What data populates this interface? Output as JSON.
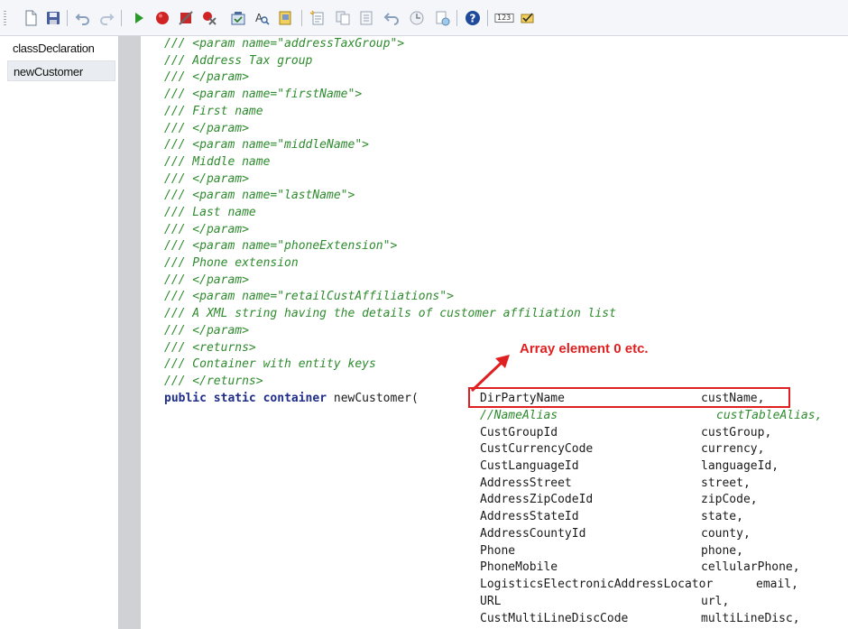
{
  "toolbar": {
    "buttons": [
      {
        "name": "new-icon"
      },
      {
        "name": "save-icon"
      },
      {
        "name": "undo-icon"
      },
      {
        "name": "redo-icon"
      },
      {
        "name": "run-icon"
      },
      {
        "name": "breakpoint-icon"
      },
      {
        "name": "enable-breakpoint-icon"
      },
      {
        "name": "remove-breakpoints-icon"
      },
      {
        "name": "compile-icon"
      },
      {
        "name": "lookup-icon"
      },
      {
        "name": "script-icon"
      },
      {
        "name": "new-method-icon"
      },
      {
        "name": "copy-icon"
      },
      {
        "name": "outline-icon"
      },
      {
        "name": "back-icon"
      },
      {
        "name": "history-icon"
      },
      {
        "name": "source-control-icon"
      },
      {
        "name": "help-icon"
      },
      {
        "name": "line-numbers-icon"
      },
      {
        "name": "best-practice-icon"
      }
    ],
    "line_numbers_label": "123"
  },
  "sidebar": {
    "items": [
      {
        "label": "classDeclaration",
        "selected": false
      },
      {
        "label": "newCustomer",
        "selected": true
      }
    ]
  },
  "code": {
    "comment_lines": [
      "/// <param name=\"addressTaxGroup\">",
      "/// Address Tax group",
      "/// </param>",
      "/// <param name=\"firstName\">",
      "/// First name",
      "/// </param>",
      "/// <param name=\"middleName\">",
      "/// Middle name",
      "/// </param>",
      "/// <param name=\"lastName\">",
      "/// Last name",
      "/// </param>",
      "/// <param name=\"phoneExtension\">",
      "/// Phone extension",
      "/// </param>",
      "/// <param name=\"retailCustAffiliations\">",
      "/// A XML string having the details of customer affiliation list",
      "/// </param>",
      "/// <returns>",
      "/// Container with entity keys",
      "/// </returns>"
    ],
    "signature": {
      "kw_public": "public",
      "kw_static": "static",
      "kw_container": "container",
      "method": "newCustomer("
    },
    "params": [
      {
        "type": "DirPartyName",
        "name": "custName,",
        "commented": false
      },
      {
        "type": "//NameAlias",
        "name": "custTableAlias,",
        "commented": true
      },
      {
        "type": "CustGroupId",
        "name": "custGroup,",
        "commented": false
      },
      {
        "type": "CustCurrencyCode",
        "name": "currency,",
        "commented": false
      },
      {
        "type": "CustLanguageId",
        "name": "languageId,",
        "commented": false
      },
      {
        "type": "AddressStreet",
        "name": "street,",
        "commented": false
      },
      {
        "type": "AddressZipCodeId",
        "name": "zipCode,",
        "commented": false
      },
      {
        "type": "AddressStateId",
        "name": "state,",
        "commented": false
      },
      {
        "type": "AddressCountyId",
        "name": "county,",
        "commented": false
      },
      {
        "type": "Phone",
        "name": "phone,",
        "commented": false
      },
      {
        "type": "PhoneMobile",
        "name": "cellularPhone,",
        "commented": false
      },
      {
        "type": "LogisticsElectronicAddressLocator",
        "name": "email,",
        "commented": false
      },
      {
        "type": "URL",
        "name": "url,",
        "commented": false
      },
      {
        "type": "CustMultiLineDiscCode",
        "name": "multiLineDisc,",
        "commented": false
      }
    ]
  },
  "annotation": {
    "text": "Array element 0 etc.",
    "color": "#e02020"
  },
  "colors": {
    "comment": "#2e8b2e",
    "keyword": "#1f2d8a",
    "gutter": "#cfd1d4"
  }
}
